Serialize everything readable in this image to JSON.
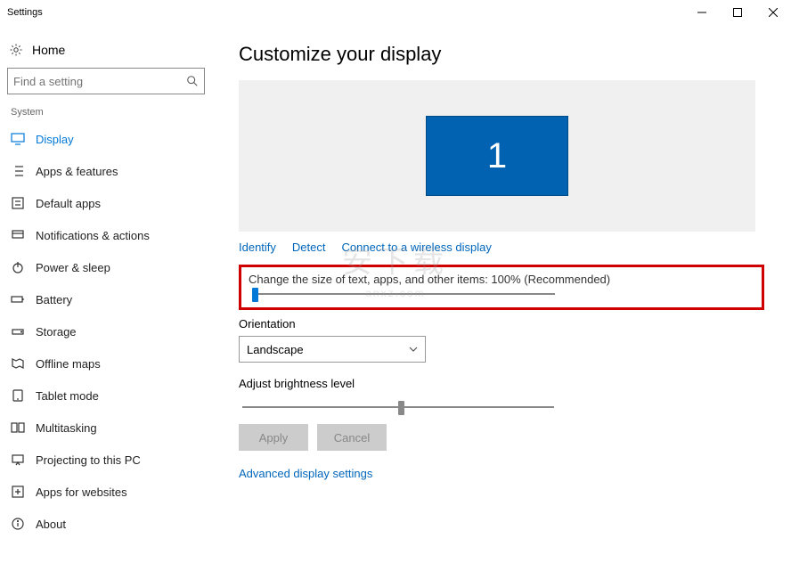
{
  "titlebar": {
    "title": "Settings"
  },
  "sidebar": {
    "home": "Home",
    "search_placeholder": "Find a setting",
    "category": "System",
    "items": [
      {
        "label": "Display"
      },
      {
        "label": "Apps & features"
      },
      {
        "label": "Default apps"
      },
      {
        "label": "Notifications & actions"
      },
      {
        "label": "Power & sleep"
      },
      {
        "label": "Battery"
      },
      {
        "label": "Storage"
      },
      {
        "label": "Offline maps"
      },
      {
        "label": "Tablet mode"
      },
      {
        "label": "Multitasking"
      },
      {
        "label": "Projecting to this PC"
      },
      {
        "label": "Apps for websites"
      },
      {
        "label": "About"
      }
    ]
  },
  "main": {
    "title": "Customize your display",
    "monitor_number": "1",
    "links": {
      "identify": "Identify",
      "detect": "Detect",
      "wireless": "Connect to a wireless display"
    },
    "scale_label": "Change the size of text, apps, and other items: 100% (Recommended)",
    "orientation_label": "Orientation",
    "orientation_value": "Landscape",
    "brightness_label": "Adjust brightness level",
    "apply": "Apply",
    "cancel": "Cancel",
    "advanced": "Advanced display settings"
  },
  "watermark": {
    "main": "安下载",
    "sub": "anxz.com"
  }
}
